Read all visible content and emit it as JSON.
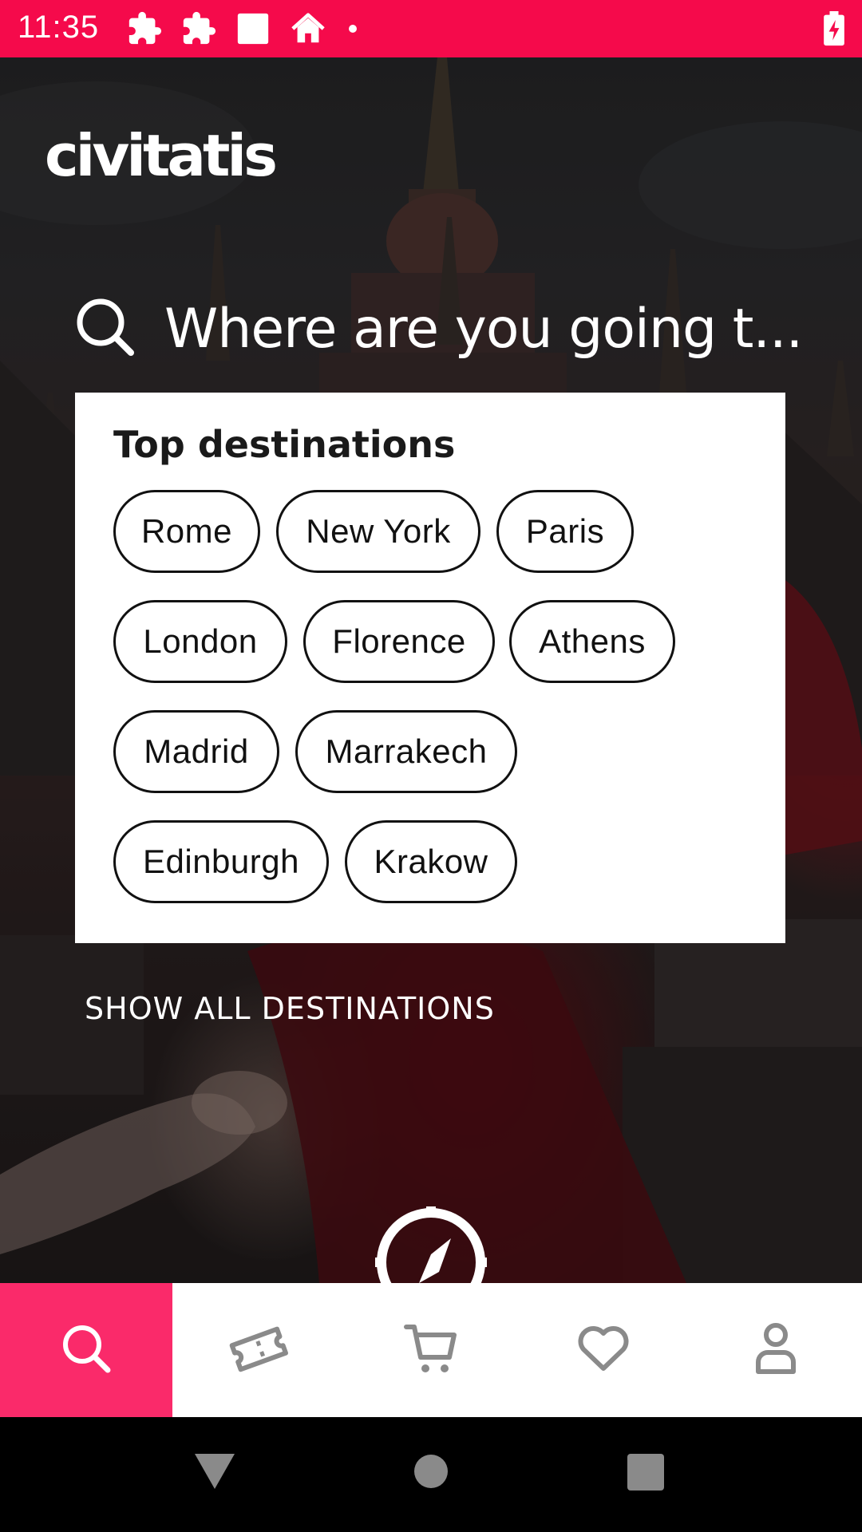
{
  "status_bar": {
    "time": "11:35",
    "icons": [
      "puzzle-icon",
      "puzzle-icon",
      "square-icon",
      "home-icon",
      "dot-icon"
    ],
    "battery_icon": "battery-charging-icon",
    "color": "#f50a4b"
  },
  "header": {
    "logo_text": "civitatis"
  },
  "search": {
    "placeholder": "Where are you going t..."
  },
  "top_destinations": {
    "title": "Top destinations",
    "items": [
      "Rome",
      "New York",
      "Paris",
      "London",
      "Florence",
      "Athens",
      "Madrid",
      "Marrakech",
      "Edinburgh",
      "Krakow"
    ]
  },
  "show_all_label": "SHOW ALL DESTINATIONS",
  "bottom_nav": {
    "items": [
      {
        "icon": "search-icon",
        "active": true
      },
      {
        "icon": "ticket-icon",
        "active": false
      },
      {
        "icon": "cart-icon",
        "active": false
      },
      {
        "icon": "heart-icon",
        "active": false
      },
      {
        "icon": "user-icon",
        "active": false
      }
    ],
    "active_color": "#fa2a6a"
  },
  "system_nav": [
    "back-icon",
    "home-circle-icon",
    "recents-icon"
  ]
}
